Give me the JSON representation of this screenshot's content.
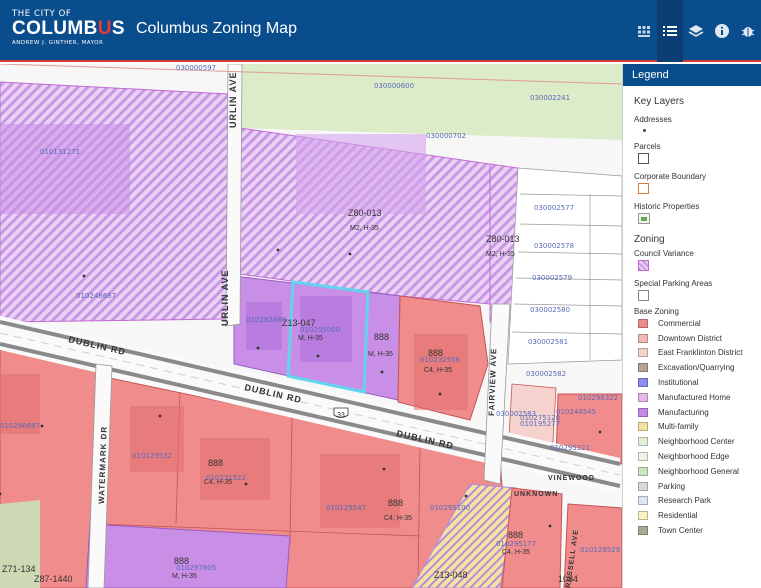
{
  "header": {
    "logo": {
      "line1": "THE CITY OF",
      "line2a": "COLUMB",
      "line2b": "U",
      "line2c": "S",
      "line3": "ANDREW J. GINTHER, MAYOR"
    },
    "title": "Columbus Zoning Map",
    "tools": [
      {
        "name": "basemap-gallery-icon",
        "active": false
      },
      {
        "name": "legend-list-icon",
        "active": true
      },
      {
        "name": "layers-icon",
        "active": false
      },
      {
        "name": "info-icon",
        "active": false
      },
      {
        "name": "bug-icon",
        "active": false
      }
    ],
    "colors": {
      "header_bg": "#0a4d8c",
      "accent": "#e23a3a"
    }
  },
  "legend": {
    "title": "Legend",
    "key_layers_title": "Key Layers",
    "key_layers": [
      "Addresses",
      "Parcels",
      "Corporate Boundary",
      "Historic Properties"
    ],
    "zoning_title": "Zoning",
    "zoning_layers": [
      "Council Variance",
      "Special Parking Areas"
    ],
    "base_zoning_title": "Base Zoning",
    "base_zoning": [
      {
        "label": "Commercial",
        "color": "#f08c8c"
      },
      {
        "label": "Downtown District",
        "color": "#f3b8b1"
      },
      {
        "label": "East Franklinton District",
        "color": "#f6d2cf"
      },
      {
        "label": "Excavation/Quarrying",
        "color": "#b6a394"
      },
      {
        "label": "Institutional",
        "color": "#8d8df0"
      },
      {
        "label": "Manufactured Home",
        "color": "#e6b8e8"
      },
      {
        "label": "Manufacturing",
        "color": "#c88ae8"
      },
      {
        "label": "Multi-family",
        "color": "#f6e2a0"
      },
      {
        "label": "Neighborhood Center",
        "color": "#e3f0d8"
      },
      {
        "label": "Neighborhood Edge",
        "color": "#eef5e6"
      },
      {
        "label": "Neighborhood General",
        "color": "#cfe5bd"
      },
      {
        "label": "Parking",
        "color": "#d9d9d9"
      },
      {
        "label": "Research Park",
        "color": "#dde6f5"
      },
      {
        "label": "Residential",
        "color": "#fbf3c0"
      },
      {
        "label": "Town Center",
        "color": "#a9ab94"
      }
    ]
  },
  "map": {
    "streets": [
      "URLIN AVE",
      "URLIN AVE",
      "DUBLIN RD",
      "DUBLIN RD",
      "DUBLIN RD",
      "WATERMARK DR",
      "FAIRVIEW AVE",
      "VINEWOOD",
      "UNKNOWN",
      "RUSSELL AVE"
    ],
    "route_shield": "33",
    "zoning_cases": [
      "Z80-013",
      "Z80-013",
      "Z13-047",
      "Z71-134",
      "Z87-1440",
      "Z13-048"
    ],
    "zoning_codes": [
      "M2, H-35",
      "M2, H-35",
      "M, H-35",
      "M, H-35",
      "C4, H-35",
      "C4, H-35",
      "C4, H-35",
      "M, H-35",
      "C4, H-35"
    ],
    "height_labels": [
      "888",
      "888",
      "888",
      "888",
      "888",
      "888"
    ],
    "parcels": [
      "030000597",
      "030000600",
      "030002241",
      "030000702",
      "010131271",
      "010248687",
      "030002577",
      "030002578",
      "030002579",
      "030002580",
      "030002581",
      "030002582",
      "030002583",
      "010296687",
      "010232556",
      "010282880",
      "010129532",
      "010129547",
      "010295100",
      "010195277",
      "010295177",
      "010295321",
      "010129529",
      "010297605",
      "010298322",
      "010275128",
      "010231522",
      "010295000",
      "010244545"
    ],
    "extra_labels": [
      "1084"
    ]
  }
}
